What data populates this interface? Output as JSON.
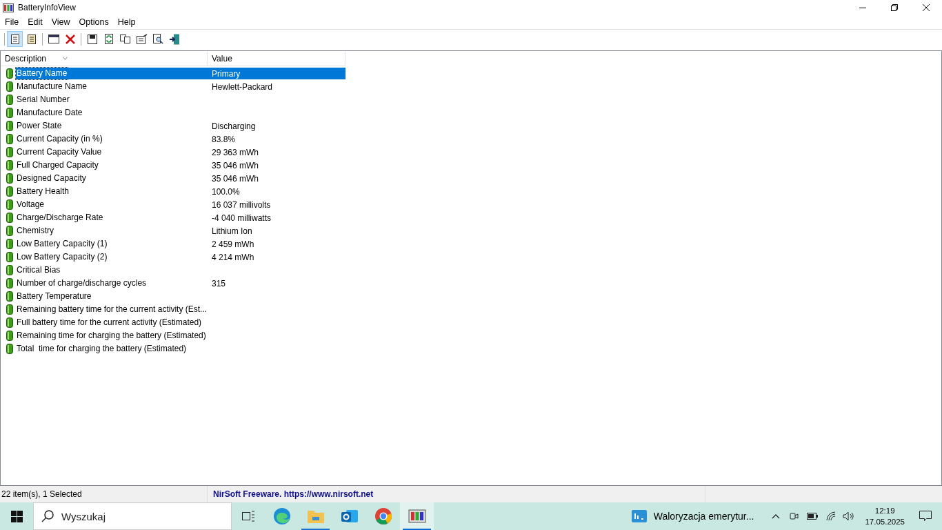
{
  "window": {
    "title": "BatteryInfoView"
  },
  "menu": [
    "File",
    "Edit",
    "View",
    "Options",
    "Help"
  ],
  "view_buttons": [
    {
      "pressed": true
    },
    {
      "pressed": false
    }
  ],
  "table": {
    "columns": [
      {
        "label": "Description",
        "sorted": true
      },
      {
        "label": "Value",
        "sorted": false
      }
    ],
    "rows": [
      {
        "description": "Battery Name",
        "value": "Primary",
        "selected": true
      },
      {
        "description": "Manufacture Name",
        "value": "Hewlett-Packard",
        "selected": false
      },
      {
        "description": "Serial Number",
        "selected": false
      },
      {
        "description": "Manufacture Date",
        "selected": false
      },
      {
        "description": "Power State",
        "value": "Discharging",
        "selected": false
      },
      {
        "description": "Current Capacity (in %)",
        "value": "83.8%",
        "selected": false
      },
      {
        "description": "Current Capacity Value",
        "value": "29 363 mWh",
        "selected": false
      },
      {
        "description": "Full Charged Capacity",
        "value": "35 046 mWh",
        "selected": false
      },
      {
        "description": "Designed Capacity",
        "value": "35 046 mWh",
        "selected": false
      },
      {
        "description": "Battery Health",
        "value": "100.0%",
        "selected": false
      },
      {
        "description": "Voltage",
        "value": "16 037 millivolts",
        "selected": false
      },
      {
        "description": "Charge/Discharge Rate",
        "value": "-4 040 milliwatts",
        "selected": false
      },
      {
        "description": "Chemistry",
        "value": "Lithium Ion",
        "selected": false
      },
      {
        "description": "Low Battery Capacity (1)",
        "value": "2 459 mWh",
        "selected": false
      },
      {
        "description": "Low Battery Capacity (2)",
        "value": "4 214 mWh",
        "selected": false
      },
      {
        "description": "Critical Bias",
        "selected": false
      },
      {
        "description": "Number of charge/discharge cycles",
        "value": "315",
        "selected": false
      },
      {
        "description": "Battery Temperature",
        "selected": false
      },
      {
        "description": "Remaining battery time for the current activity (Est...",
        "selected": false
      },
      {
        "description": "Full battery time for the current activity (Estimated)",
        "selected": false
      },
      {
        "description": "Remaining time for charging the battery (Estimated)",
        "selected": false
      },
      {
        "description": "Total  time for charging the battery (Estimated)",
        "selected": false
      }
    ]
  },
  "status_bar": {
    "count": "22 item(s), 1 Selected",
    "link": "NirSoft Freeware. https://www.nirsoft.net"
  },
  "taskbar": {
    "search": {
      "placeholder": "Wyszukaj"
    },
    "apps": [
      {
        "kind": "edge",
        "running": false,
        "active": false
      },
      {
        "kind": "folder",
        "running": true,
        "active": false
      },
      {
        "kind": "outlook",
        "running": false,
        "active": false
      },
      {
        "kind": "chrome",
        "running": false,
        "active": false
      },
      {
        "kind": "battery",
        "running": true,
        "active": true
      }
    ],
    "news": "Waloryzacja emerytur...",
    "time": "12:19",
    "date": "17.05.2025"
  }
}
